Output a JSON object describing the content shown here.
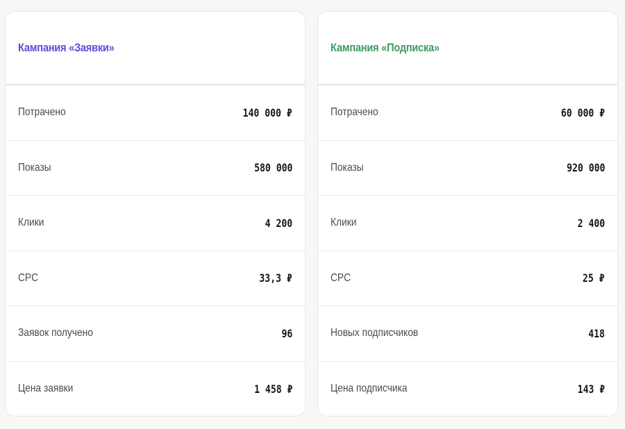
{
  "campaigns": [
    {
      "title": "Кампания «Заявки»",
      "accent": "#5b4fd6",
      "rows": [
        {
          "label": "Потрачено",
          "value": "140 000 ₽"
        },
        {
          "label": "Показы",
          "value": "580 000"
        },
        {
          "label": "Клики",
          "value": "4 200"
        },
        {
          "label": "CPC",
          "value": "33,3 ₽"
        },
        {
          "label": "Заявок получено",
          "value": "96"
        },
        {
          "label": "Цена заявки",
          "value": "1 458 ₽"
        }
      ]
    },
    {
      "title": "Кампания «Подписка»",
      "accent": "#3e9a62",
      "rows": [
        {
          "label": "Потрачено",
          "value": "60 000 ₽"
        },
        {
          "label": "Показы",
          "value": "920 000"
        },
        {
          "label": "Клики",
          "value": "2 400"
        },
        {
          "label": "CPC",
          "value": "25 ₽"
        },
        {
          "label": "Новых подписчиков",
          "value": "418"
        },
        {
          "label": "Цена подписчика",
          "value": "143 ₽"
        }
      ]
    }
  ]
}
